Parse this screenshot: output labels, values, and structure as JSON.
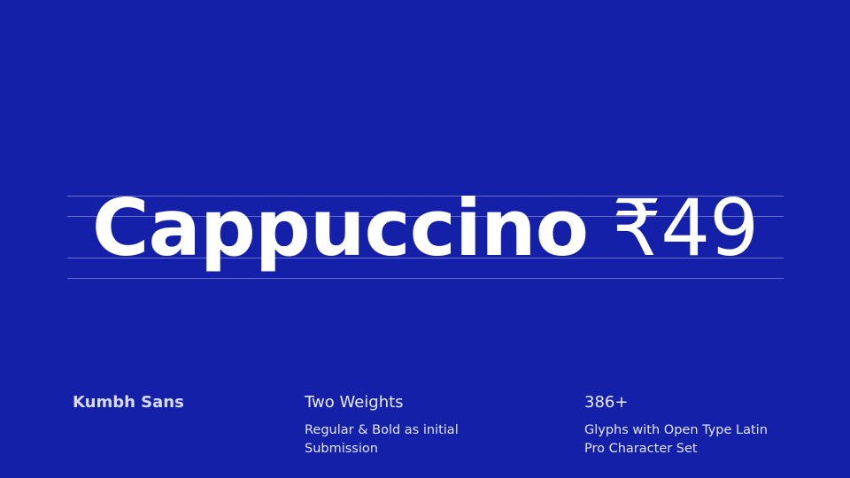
{
  "colors": {
    "background": "#1420a8",
    "text": "#ffffff",
    "guide_lines": "rgba(255,255,255,0.35)"
  },
  "headline": {
    "word": "Cappuccino",
    "price": "₹49"
  },
  "info": {
    "font_name": {
      "title": "Kumbh Sans"
    },
    "weights": {
      "title": "Two Weights",
      "lines": [
        "Regular & Bold as initial",
        "Submission"
      ]
    },
    "glyphs": {
      "title": "386+",
      "lines": [
        "Glyphs with Open Type Latin",
        "Pro Character Set"
      ]
    }
  }
}
